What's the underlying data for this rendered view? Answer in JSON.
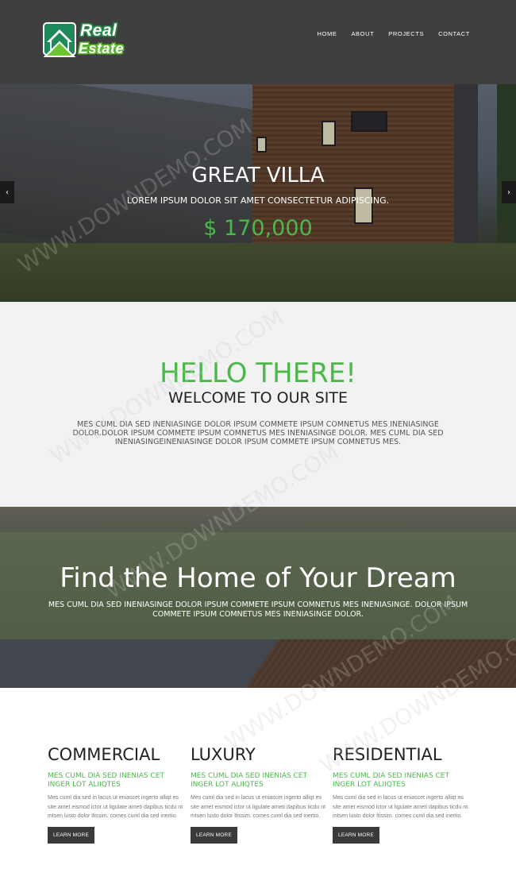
{
  "header": {
    "logo_word1": "Real",
    "logo_word2": "Estate",
    "nav": [
      "HOME",
      "ABOUT",
      "PROJECTS",
      "CONTACT"
    ]
  },
  "hero": {
    "title": "GREAT VILLA",
    "subtitle": "LOREM IPSUM DOLOR SIT AMET CONSECTETUR ADIPISCING.",
    "price": "$ 170,000",
    "prev_arrow": "‹",
    "next_arrow": "›"
  },
  "hello": {
    "title": "HELLO THERE!",
    "subtitle": "WELCOME TO OUR SITE",
    "text": "MES CUML DIA SED INENIASINGE DOLOR IPSUM COMMETE IPSUM COMNETUS MES INENIASINGE DOLOR.DOLOR IPSUM COMMETE IPSUM COMNETUS MES INENIASINGE DOLOR. MES CUML DIA SED INENIASINGEINENIASINGE DOLOR IPSUM COMMETE IPSUM COMNETUS MES."
  },
  "dream": {
    "title": "Find the Home of Your Dream",
    "text": "MES CUML DIA SED INENIASINGE DOLOR IPSUM COMMETE IPSUM COMNETUS MES INENIASINGE. DOLOR IPSUM COMMETE IPSUM COMNETUS MES INENIASINGE DOLOR."
  },
  "features": [
    {
      "title": "COMMERCIAL",
      "subtitle": "MES CUML DIA SED INENIAS CET INGER LOT ALIIQTES",
      "text": "Mes cuml dia sed in lacus ut eniascet ingerto alliqt es site amet eismod ictor ut ligulate ameti dapibus ticdu nt mtsen lusto dolor ltissim. comes cuml dia sed inertio.",
      "button": "LEARN MORE"
    },
    {
      "title": "LUXURY",
      "subtitle": "MES CUML DIA SED INENIAS CET INGER LOT ALIIQTES",
      "text": "Mes cuml dia sed in lacus ut eniascet ingerto alliqt es site amet eismod ictor ut ligulate ameti dapibus ticdu nt mtsen lusto dolor ltissim. comes cuml dia sed inertio.",
      "button": "LEARN MORE"
    },
    {
      "title": "RESIDENTIAL",
      "subtitle": "MES CUML DIA SED INENIAS CET INGER LOT ALIIQTES",
      "text": "Mes cuml dia sed in lacus ut eniascet ingerto alliqt es site amet eismod ictor ut ligulate ameti dapibus ticdu nt mtsen lusto dolor ltissim. comes cuml dia sed inertio.",
      "button": "LEARN MORE"
    }
  ],
  "watermark": "WWW.DOWNDEMO.COM",
  "colors": {
    "header_bg": "#3f3f3f",
    "accent_green": "#4cb84c",
    "section_gray": "#f2f2f2",
    "button_dark": "#3a3a3a"
  }
}
